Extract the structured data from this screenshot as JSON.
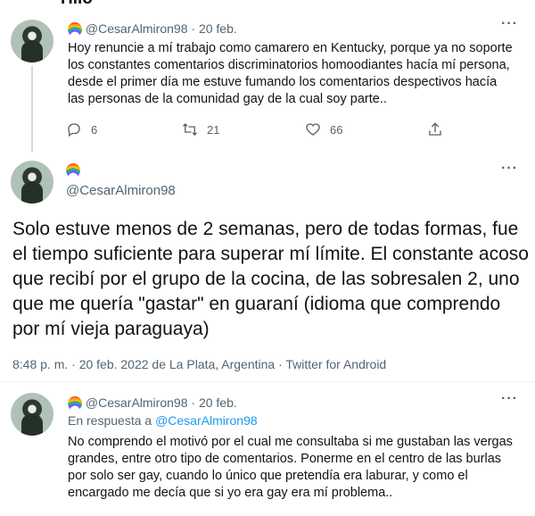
{
  "header": {
    "title": "Hilo"
  },
  "tweet1": {
    "handle": "@CesarAlmiron98",
    "sep": "·",
    "date": "20 feb.",
    "text": "Hoy renuncie a mí trabajo como camarero en Kentucky, porque ya no soporte los constantes comentarios discriminatorios homoodiantes hacía mí persona, desde el primer día me estuve fumando los comentarios despectivos hacía las personas de la comunidad gay de la cual soy parte..",
    "replies": "6",
    "retweets": "21",
    "likes": "66"
  },
  "tweet2": {
    "handle": "@CesarAlmiron98",
    "text": "Solo estuve menos de 2 semanas, pero de todas formas, fue el tiempo suficiente para superar mí límite. El constante acoso que recibí por el grupo de la cocina, de las sobresalen 2, uno que me quería \"gastar\" en guaraní (idioma que comprendo por mí vieja paraguaya)",
    "timestamp": "8:48 p. m. · 20 feb. 2022 de La Plata, Argentina · Twitter for Android"
  },
  "tweet3": {
    "handle": "@CesarAlmiron98",
    "sep": "·",
    "date": "20 feb.",
    "reply_prefix": "En respuesta a",
    "reply_handle": "@CesarAlmiron98",
    "text": "No comprendo el motivó por el cual me consultaba si me gustaban las vergas grandes, entre otro tipo de comentarios. Ponerme en el centro de las burlas por solo ser gay, cuando lo único que pretendía era laburar, y como el encargado me decía que si yo era gay era mí problema.."
  },
  "icons": {
    "reply": "reply-icon",
    "retweet": "retweet-icon",
    "like": "heart-icon",
    "share": "share-icon",
    "more": "more-icon",
    "rainbow": "rainbow-emoji"
  },
  "colors": {
    "link": "#1d9bf0",
    "muted": "#536471",
    "text": "#0f1419"
  }
}
